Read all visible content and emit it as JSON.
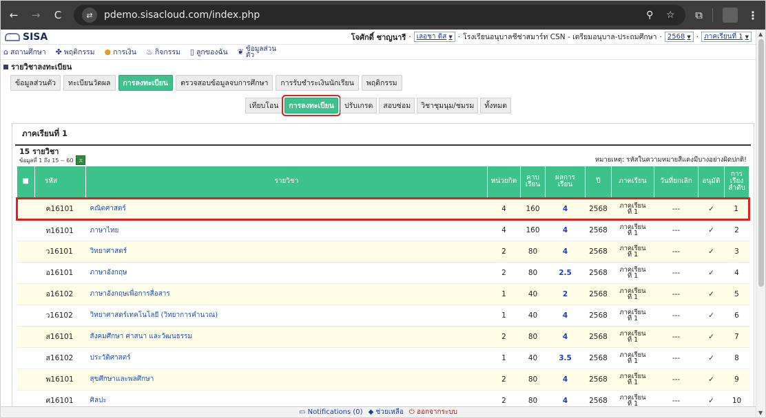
{
  "browser": {
    "url": "pdemo.sisacloud.com/index.php",
    "back_icon": "←",
    "forward_icon": "→",
    "reload_icon": "C",
    "tune_icon": "⇄",
    "zoom_icon": "⚲",
    "star_icon": "☆",
    "ext_icon": "⧉",
    "menu_icon": "⋮"
  },
  "header": {
    "logo_text": "SISA",
    "user_name": "โจศักดิ์ ชาญนารี",
    "student_select": "เลอชา ดิส",
    "school": "โรงเรียนอนุบาลชีช่าสมาร์ท CSN - เตรียมอนุบาล-ประถมศึกษา",
    "year_select": "2568",
    "term_select": "ภาคเรียนที่ 1"
  },
  "menu": {
    "items": [
      {
        "icon": "⌂",
        "label": "สถานศึกษา"
      },
      {
        "icon": "✤",
        "label": "พฤติกรรม"
      },
      {
        "icon": "●",
        "label": "การเงิน"
      },
      {
        "icon": "♨",
        "label": "กิจกรรม"
      },
      {
        "icon": "▯",
        "label": "ลูกของฉัน"
      }
    ],
    "personal_icon": "❦",
    "personal_line1": "ข้อมูลส่วน",
    "personal_line2": "ตัว"
  },
  "section_title": "รายวิชาลงทะเบียน",
  "tabs1": [
    "ข้อมูลส่วนตัว",
    "ทะเบียนวัดผล",
    "การลงทะเบียน",
    "ตรวจสอบข้อมูลจบการศึกษา",
    "การรับชำระเงินนักเรียน",
    "พฤติกรรม"
  ],
  "tabs2": [
    "เทียบโอน",
    "การลงทะเบียน",
    "ปรับเกรด",
    "สอบซ่อม",
    "วิชาชุมนุม/ชมรม",
    "ทั้งหมด"
  ],
  "panel": {
    "title": "ภาคเรียนที่ 1",
    "count": "15 รายวิชา",
    "range": "ข้อมูลที่ 1 ถึง 15 -- 60",
    "excel_icon": "X",
    "note": "หมายเหตุ: รหัสในความหมายสีแดงมีบางอย่างผิดปกติ!"
  },
  "table": {
    "headers": {
      "select": "■",
      "code": "รหัส",
      "name": "รายวิชา",
      "credit": "หน่วยกิต",
      "hours1": "คาบ",
      "hours2": "เรียน",
      "grade1": "ผลการ",
      "grade2": "เรียน",
      "year": "ปี",
      "term": "ภาคเรียน",
      "cancel": "วันที่ยกเลิก",
      "approve": "อนุมัติ",
      "order1": "การ",
      "order2": "เรียง",
      "order3": "ลำดับ"
    },
    "rows": [
      {
        "code": "ค16101",
        "name": "คณิตศาสตร์",
        "credit": "4",
        "hours": "160",
        "grade": "4",
        "year": "2568",
        "term1": "ภาคเรียน",
        "term2": "ที่ 1",
        "cancel": "---",
        "approve": "✓",
        "order": "1"
      },
      {
        "code": "ท16101",
        "name": "ภาษาไทย",
        "credit": "4",
        "hours": "160",
        "grade": "4",
        "year": "2568",
        "term1": "ภาคเรียน",
        "term2": "ที่ 1",
        "cancel": "---",
        "approve": "✓",
        "order": "2"
      },
      {
        "code": "ว16101",
        "name": "วิทยาศาสตร์",
        "credit": "2",
        "hours": "80",
        "grade": "4",
        "year": "2568",
        "term1": "ภาคเรียน",
        "term2": "ที่ 1",
        "cancel": "---",
        "approve": "✓",
        "order": "3"
      },
      {
        "code": "อ16101",
        "name": "ภาษาอังกฤษ",
        "credit": "2",
        "hours": "80",
        "grade": "2.5",
        "year": "2568",
        "term1": "ภาคเรียน",
        "term2": "ที่ 1",
        "cancel": "---",
        "approve": "✓",
        "order": "4"
      },
      {
        "code": "อ16102",
        "name": "ภาษาอังกฤษเพื่อการสื่อสาร",
        "credit": "1",
        "hours": "40",
        "grade": "2",
        "year": "2568",
        "term1": "ภาคเรียน",
        "term2": "ที่ 1",
        "cancel": "---",
        "approve": "✓",
        "order": "5"
      },
      {
        "code": "ว16102",
        "name": "วิทยาศาสตร์เทคโนโลยี (วิทยาการคำนวณ)",
        "credit": "1",
        "hours": "40",
        "grade": "4",
        "year": "2568",
        "term1": "ภาคเรียน",
        "term2": "ที่ 1",
        "cancel": "---",
        "approve": "✓",
        "order": "6"
      },
      {
        "code": "ส16101",
        "name": "สังคมศึกษา ศาสนา และวัฒนธรรม",
        "credit": "2",
        "hours": "80",
        "grade": "4",
        "year": "2568",
        "term1": "ภาคเรียน",
        "term2": "ที่ 1",
        "cancel": "---",
        "approve": "✓",
        "order": "7"
      },
      {
        "code": "ส16102",
        "name": "ประวัติศาสตร์",
        "credit": "1",
        "hours": "40",
        "grade": "3.5",
        "year": "2568",
        "term1": "ภาคเรียน",
        "term2": "ที่ 1",
        "cancel": "---",
        "approve": "✓",
        "order": "8"
      },
      {
        "code": "พ16101",
        "name": "สุขศึกษาและพลศึกษา",
        "credit": "2",
        "hours": "80",
        "grade": "4",
        "year": "2568",
        "term1": "ภาคเรียน",
        "term2": "ที่ 1",
        "cancel": "---",
        "approve": "✓",
        "order": "9"
      },
      {
        "code": "ศ16101",
        "name": "ศิลปะ",
        "credit": "2",
        "hours": "80",
        "grade": "4",
        "year": "2568",
        "term1": "ภาคเรียน",
        "term2": "ที่ 1",
        "cancel": "---",
        "approve": "✓",
        "order": "10"
      }
    ]
  },
  "statusbar": {
    "notifications": "Notifications (0)",
    "help": "ช่วยเหลือ",
    "logout": "ออกจากระบบ"
  }
}
